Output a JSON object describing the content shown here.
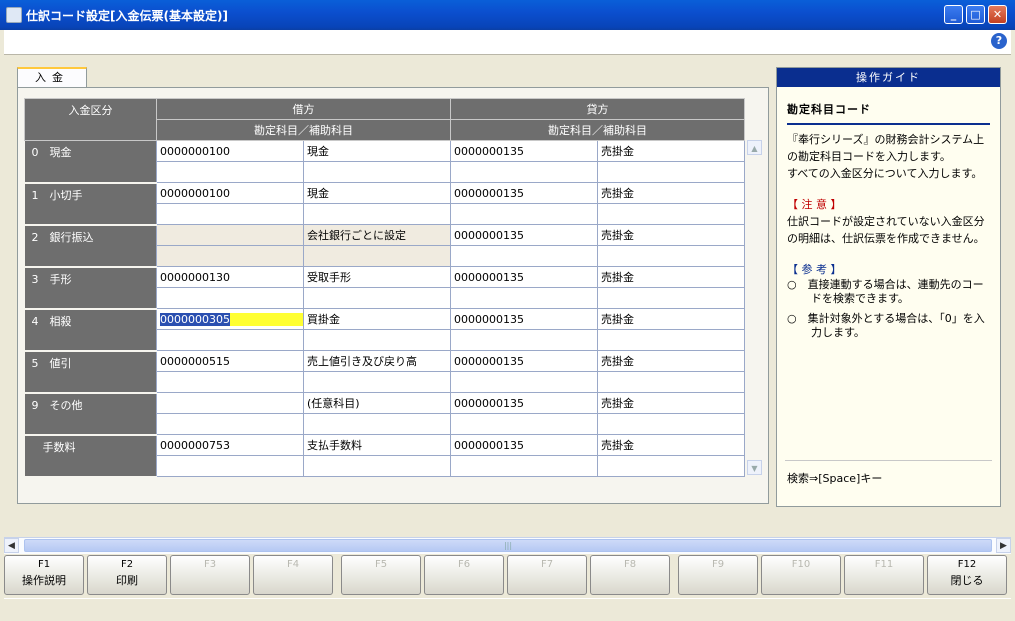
{
  "window": {
    "title": "仕訳コード設定[入金伝票(基本設定)]"
  },
  "tab": {
    "label": "入金"
  },
  "grid": {
    "headers": {
      "kbn": "入金区分",
      "debit": "借方",
      "credit": "貸方",
      "debit_sub": "勘定科目／補助科目",
      "credit_sub": "勘定科目／補助科目"
    },
    "rows": [
      {
        "kbn": "0　現金",
        "d_code": "0000000100",
        "d_name": "現金",
        "c_code": "0000000135",
        "c_name": "売掛金"
      },
      {
        "kbn": "1　小切手",
        "d_code": "0000000100",
        "d_name": "現金",
        "c_code": "0000000135",
        "c_name": "売掛金"
      },
      {
        "kbn": "2　銀行振込",
        "d_code": "",
        "d_name": "会社銀行ごとに設定",
        "c_code": "0000000135",
        "c_name": "売掛金"
      },
      {
        "kbn": "3　手形",
        "d_code": "0000000130",
        "d_name": "受取手形",
        "c_code": "0000000135",
        "c_name": "売掛金"
      },
      {
        "kbn": "4　相殺",
        "d_code": "0000000305",
        "d_name": "買掛金",
        "c_code": "0000000135",
        "c_name": "売掛金"
      },
      {
        "kbn": "5　値引",
        "d_code": "0000000515",
        "d_name": "売上値引き及び戻り高",
        "c_code": "0000000135",
        "c_name": "売掛金"
      },
      {
        "kbn": "9　その他",
        "d_code": "",
        "d_name": "(任意科目)",
        "c_code": "0000000135",
        "c_name": "売掛金"
      },
      {
        "kbn": "　手数料",
        "d_code": "0000000753",
        "d_name": "支払手数料",
        "c_code": "0000000135",
        "c_name": "売掛金"
      }
    ]
  },
  "guide": {
    "header": "操作ガイド",
    "subtitle": "勘定科目コード",
    "p1": "『奉行シリーズ』の財務会計システム上の勘定科目コードを入力します。",
    "p2": "すべての入金区分について入力します。",
    "note_title": "【 注 意 】",
    "note_text": "仕訳コードが設定されていない入金区分の明細は、仕訳伝票を作成できません。",
    "ref_title": "【 参 考 】",
    "ref1": "○　直接連動する場合は、連動先のコードを検索できます。",
    "ref2": "○　集計対象外とする場合は、「0」を入力します。",
    "search": "検索⇒[Space]キー"
  },
  "fkeys": [
    {
      "key": "F1",
      "label": "操作説明",
      "enabled": true
    },
    {
      "key": "F2",
      "label": "印刷",
      "enabled": true
    },
    {
      "key": "F3",
      "label": "",
      "enabled": false
    },
    {
      "key": "F4",
      "label": "",
      "enabled": false
    },
    {
      "key": "F5",
      "label": "",
      "enabled": false
    },
    {
      "key": "F6",
      "label": "",
      "enabled": false
    },
    {
      "key": "F7",
      "label": "",
      "enabled": false
    },
    {
      "key": "F8",
      "label": "",
      "enabled": false
    },
    {
      "key": "F9",
      "label": "",
      "enabled": false
    },
    {
      "key": "F10",
      "label": "",
      "enabled": false
    },
    {
      "key": "F11",
      "label": "",
      "enabled": false
    },
    {
      "key": "F12",
      "label": "閉じる",
      "enabled": true
    }
  ]
}
